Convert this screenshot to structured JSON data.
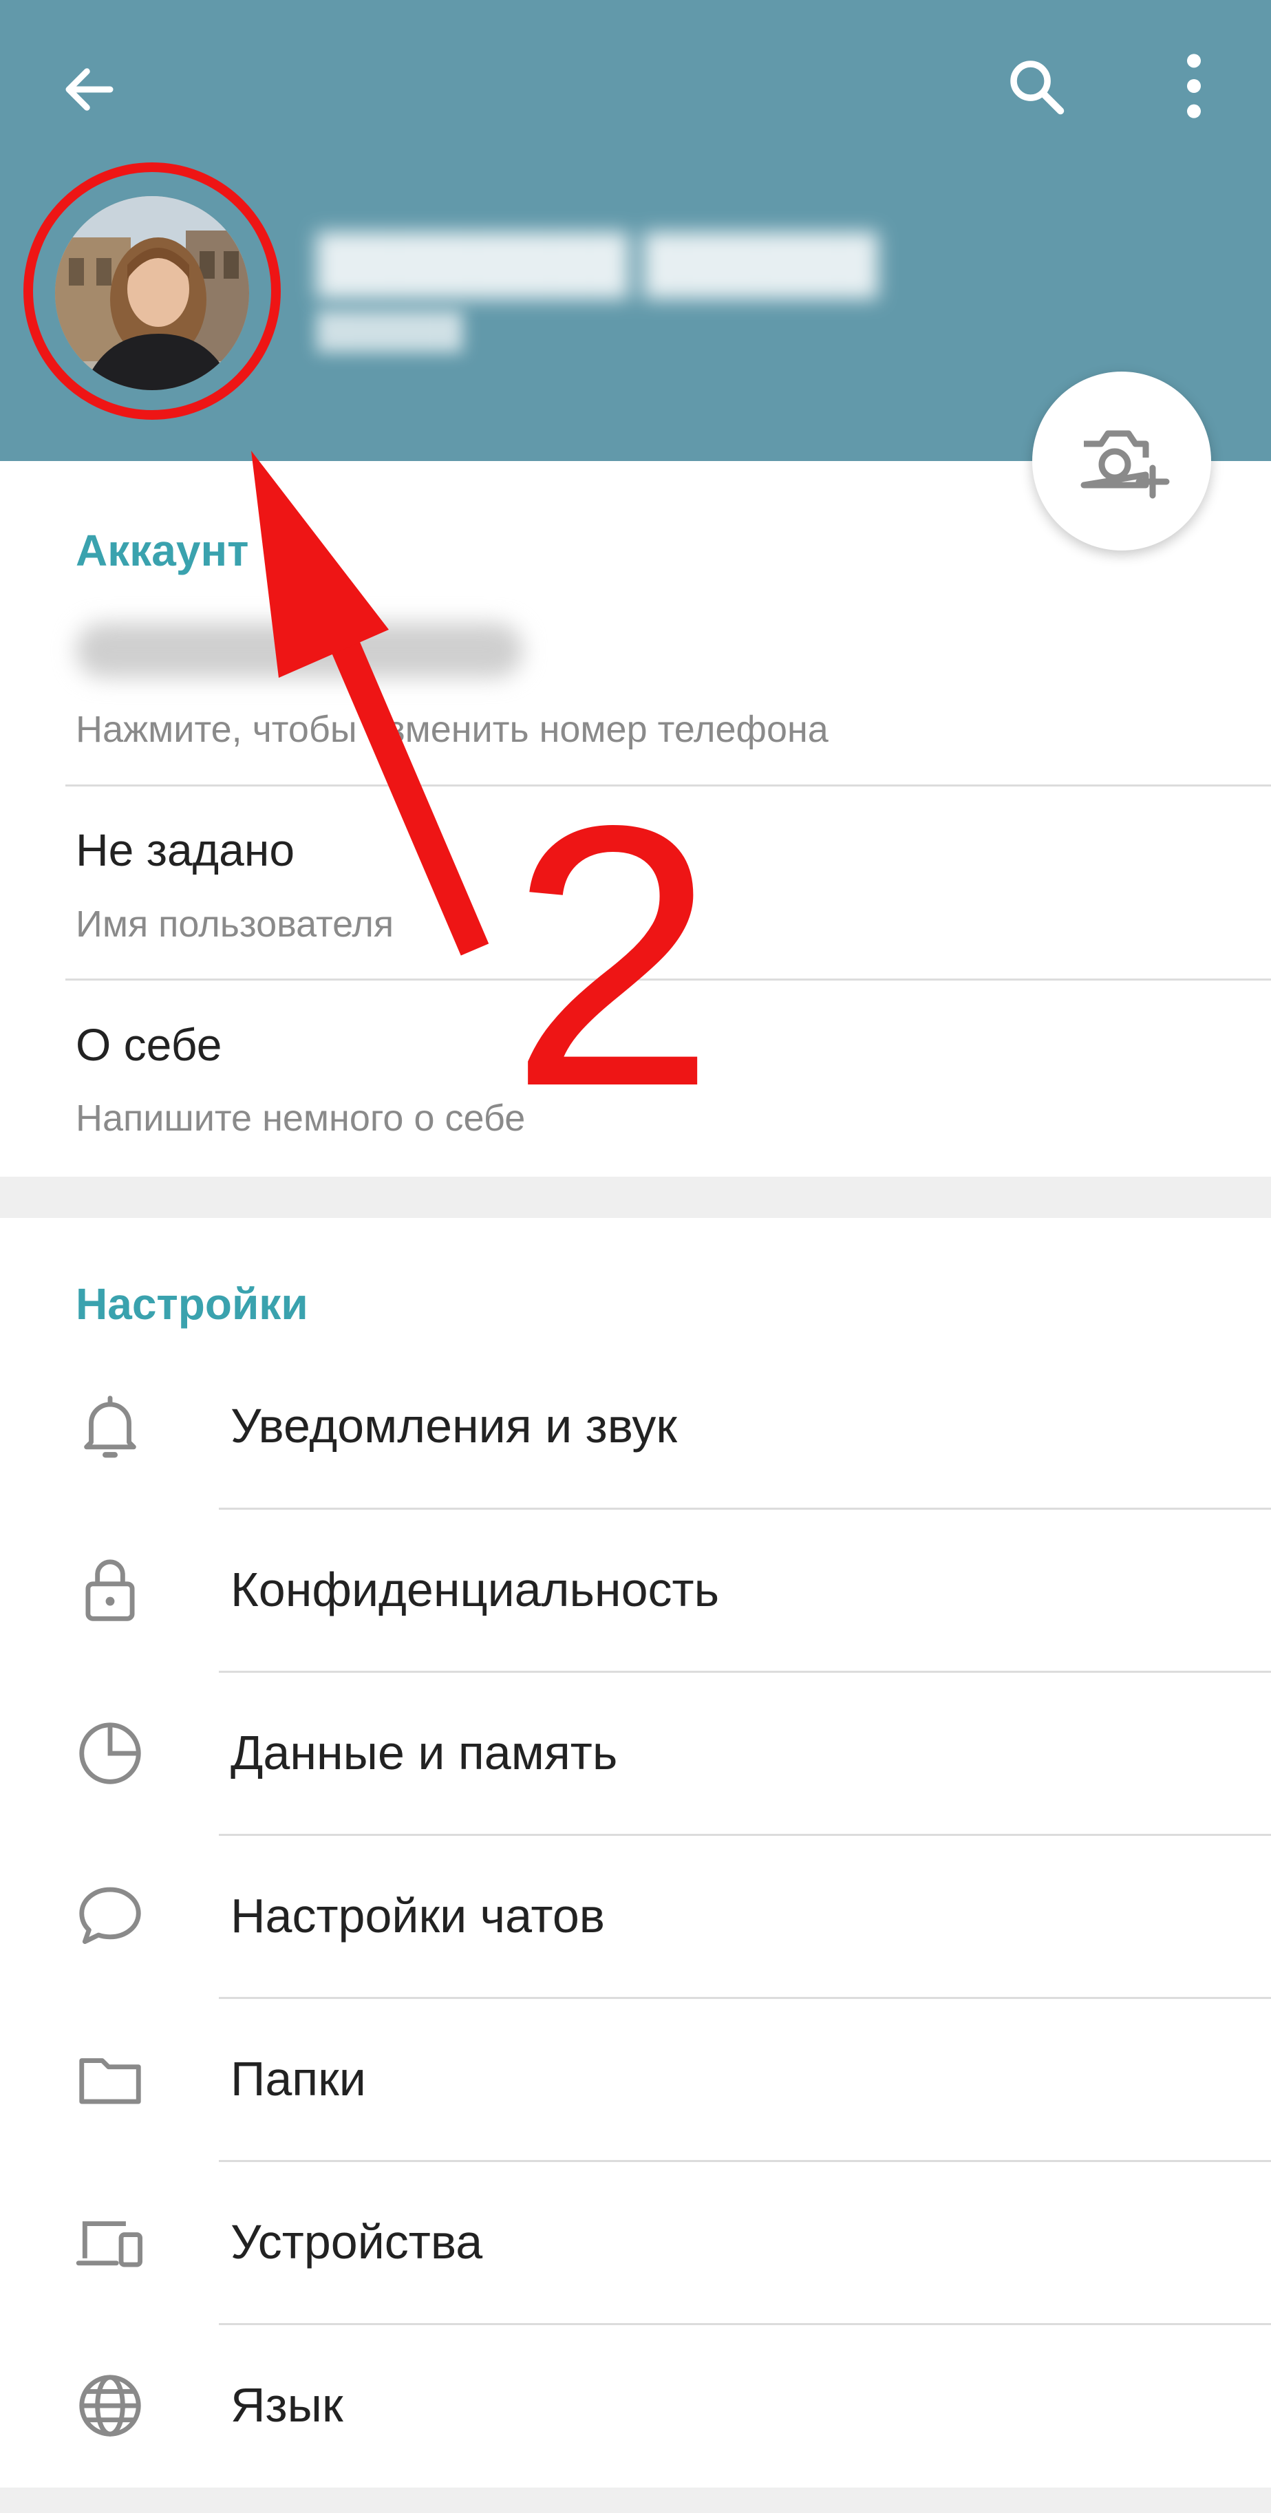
{
  "header": {
    "background": "#6299aa",
    "back_icon": "arrow-left-icon",
    "search_icon": "search-icon",
    "more_icon": "more-vertical-icon",
    "camera_icon": "camera-add-icon"
  },
  "account": {
    "title": "Аккаунт",
    "phone_hint": "Нажмите, чтобы изменить номер телефона",
    "username_value": "Не задано",
    "username_hint": "Имя пользователя",
    "bio_value": "О себе",
    "bio_hint": "Напишите немного о себе"
  },
  "settings": {
    "title": "Настройки",
    "items": [
      {
        "label": "Уведомления и звук",
        "icon": "bell-icon"
      },
      {
        "label": "Конфиденциальность",
        "icon": "lock-icon"
      },
      {
        "label": "Данные и память",
        "icon": "pie-chart-icon"
      },
      {
        "label": "Настройки чатов",
        "icon": "chat-bubble-icon"
      },
      {
        "label": "Папки",
        "icon": "folder-icon"
      },
      {
        "label": "Устройства",
        "icon": "devices-icon"
      },
      {
        "label": "Язык",
        "icon": "globe-icon"
      }
    ]
  },
  "annotation": {
    "step_number": "2",
    "color": "#ee1515"
  },
  "colors": {
    "accent": "#3aa2ae",
    "icon_gray": "#8a8a8a",
    "text": "#222222"
  }
}
